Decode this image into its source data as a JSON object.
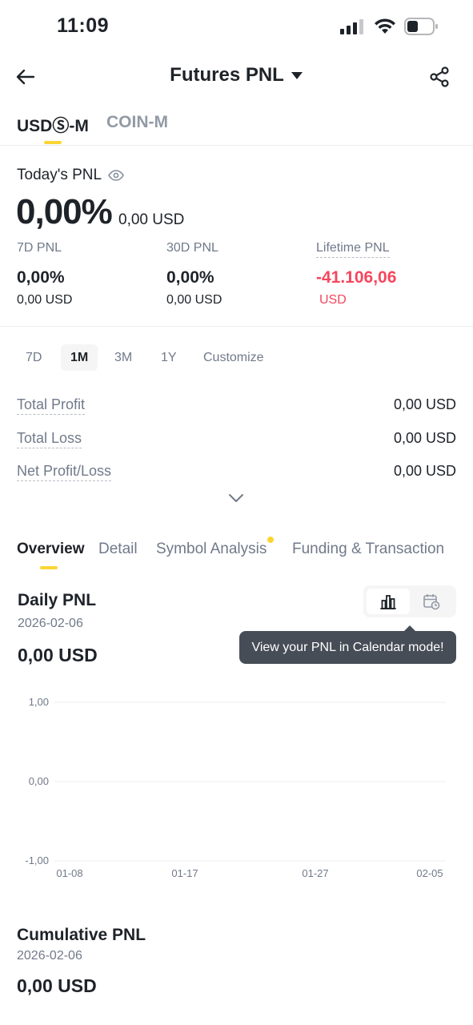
{
  "status_bar": {
    "time": "11:09"
  },
  "header": {
    "title": "Futures PNL"
  },
  "top_tabs": [
    {
      "label": "USDⓈ-M",
      "active": true
    },
    {
      "label": "COIN-M",
      "active": false
    }
  ],
  "today": {
    "label": "Today's PNL",
    "percent": "0,00%",
    "usd": "0,00 USD"
  },
  "stats": [
    {
      "label": "7D PNL",
      "percent": "0,00%",
      "usd": "0,00 USD"
    },
    {
      "label": "30D PNL",
      "percent": "0,00%",
      "usd": "0,00 USD"
    },
    {
      "label": "Lifetime PNL",
      "percent": "-41.106,06",
      "usd": "USD"
    }
  ],
  "range_tabs": [
    "7D",
    "1M",
    "3M",
    "1Y",
    "Customize"
  ],
  "range_active": "1M",
  "summary": [
    {
      "label": "Total Profit",
      "value": "0,00 USD"
    },
    {
      "label": "Total Loss",
      "value": "0,00 USD"
    },
    {
      "label": "Net Profit/Loss",
      "value": "0,00 USD"
    }
  ],
  "section_tabs": [
    "Overview",
    "Detail",
    "Symbol Analysis",
    "Funding & Transaction"
  ],
  "section_active": "Overview",
  "daily": {
    "title": "Daily PNL",
    "date": "2026-02-06",
    "value": "0,00 USD"
  },
  "tooltip": "View your PNL in Calendar mode!",
  "chart_data": {
    "type": "bar",
    "title": "",
    "xlabel": "",
    "ylabel": "",
    "ylim": [
      -1,
      1
    ],
    "y_ticks": [
      "1,00",
      "0,00",
      "-1,00"
    ],
    "x_ticks": [
      "01-08",
      "01-17",
      "01-27",
      "02-05"
    ],
    "series": [
      {
        "values": []
      }
    ],
    "grid": true
  },
  "cumulative": {
    "title": "Cumulative PNL",
    "date": "2026-02-06",
    "value": "0,00 USD"
  },
  "colors": {
    "accent": "#fcd535",
    "negative": "#f6465d",
    "text": "#1e2329",
    "muted": "#707a8a"
  }
}
